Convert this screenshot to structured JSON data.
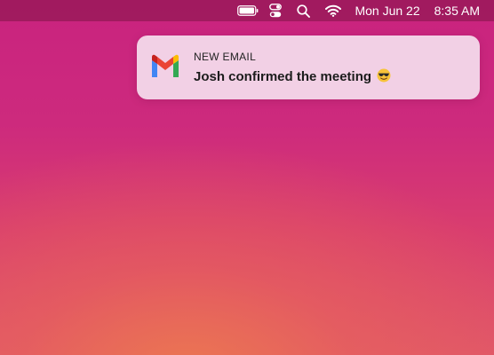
{
  "menubar": {
    "battery_icon": "battery-icon",
    "control_center_icon": "control-center-icon",
    "search_icon": "search-icon",
    "wifi_icon": "wifi-icon",
    "date": "Mon Jun 22",
    "time": "8:35 AM"
  },
  "notification": {
    "app_icon": "gmail-icon",
    "title": "NEW EMAIL",
    "message": "Josh confirmed the meeting",
    "emoji_icon": "sunglasses-emoji-icon"
  },
  "colors": {
    "menubar_text": "#ffffff",
    "notification_bg": "#f3d6e8",
    "gmail_red": "#ea4335",
    "gmail_blue": "#4285f4",
    "gmail_green": "#34a853",
    "gmail_yellow": "#fbbc04"
  }
}
